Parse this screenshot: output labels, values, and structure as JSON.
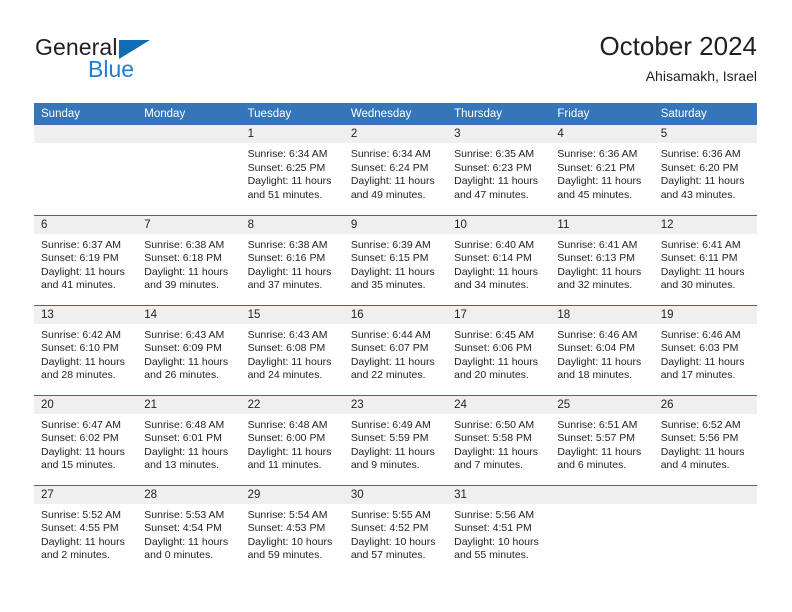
{
  "brand": {
    "name_part1": "General",
    "name_part2": "Blue",
    "triangle_color": "#0f6cb5",
    "blue_color": "#1b7fd4"
  },
  "header": {
    "title": "October 2024",
    "subtitle": "Ahisamakh, Israel"
  },
  "theme": {
    "header_bg": "#3576b8",
    "row_divider": "#2b6cab",
    "daynum_band_bg": "#efefef",
    "text_color": "#231f20"
  },
  "calendar": {
    "weekday_headers": [
      "Sunday",
      "Monday",
      "Tuesday",
      "Wednesday",
      "Thursday",
      "Friday",
      "Saturday"
    ],
    "weeks": [
      [
        {
          "day": "",
          "empty": true,
          "sunrise": "",
          "sunset": "",
          "daylight_line1": "",
          "daylight_line2": ""
        },
        {
          "day": "",
          "empty": true,
          "sunrise": "",
          "sunset": "",
          "daylight_line1": "",
          "daylight_line2": ""
        },
        {
          "day": "1",
          "empty": false,
          "sunrise": "Sunrise: 6:34 AM",
          "sunset": "Sunset: 6:25 PM",
          "daylight_line1": "Daylight: 11 hours",
          "daylight_line2": "and 51 minutes."
        },
        {
          "day": "2",
          "empty": false,
          "sunrise": "Sunrise: 6:34 AM",
          "sunset": "Sunset: 6:24 PM",
          "daylight_line1": "Daylight: 11 hours",
          "daylight_line2": "and 49 minutes."
        },
        {
          "day": "3",
          "empty": false,
          "sunrise": "Sunrise: 6:35 AM",
          "sunset": "Sunset: 6:23 PM",
          "daylight_line1": "Daylight: 11 hours",
          "daylight_line2": "and 47 minutes."
        },
        {
          "day": "4",
          "empty": false,
          "sunrise": "Sunrise: 6:36 AM",
          "sunset": "Sunset: 6:21 PM",
          "daylight_line1": "Daylight: 11 hours",
          "daylight_line2": "and 45 minutes."
        },
        {
          "day": "5",
          "empty": false,
          "sunrise": "Sunrise: 6:36 AM",
          "sunset": "Sunset: 6:20 PM",
          "daylight_line1": "Daylight: 11 hours",
          "daylight_line2": "and 43 minutes."
        }
      ],
      [
        {
          "day": "6",
          "empty": false,
          "sunrise": "Sunrise: 6:37 AM",
          "sunset": "Sunset: 6:19 PM",
          "daylight_line1": "Daylight: 11 hours",
          "daylight_line2": "and 41 minutes."
        },
        {
          "day": "7",
          "empty": false,
          "sunrise": "Sunrise: 6:38 AM",
          "sunset": "Sunset: 6:18 PM",
          "daylight_line1": "Daylight: 11 hours",
          "daylight_line2": "and 39 minutes."
        },
        {
          "day": "8",
          "empty": false,
          "sunrise": "Sunrise: 6:38 AM",
          "sunset": "Sunset: 6:16 PM",
          "daylight_line1": "Daylight: 11 hours",
          "daylight_line2": "and 37 minutes."
        },
        {
          "day": "9",
          "empty": false,
          "sunrise": "Sunrise: 6:39 AM",
          "sunset": "Sunset: 6:15 PM",
          "daylight_line1": "Daylight: 11 hours",
          "daylight_line2": "and 35 minutes."
        },
        {
          "day": "10",
          "empty": false,
          "sunrise": "Sunrise: 6:40 AM",
          "sunset": "Sunset: 6:14 PM",
          "daylight_line1": "Daylight: 11 hours",
          "daylight_line2": "and 34 minutes."
        },
        {
          "day": "11",
          "empty": false,
          "sunrise": "Sunrise: 6:41 AM",
          "sunset": "Sunset: 6:13 PM",
          "daylight_line1": "Daylight: 11 hours",
          "daylight_line2": "and 32 minutes."
        },
        {
          "day": "12",
          "empty": false,
          "sunrise": "Sunrise: 6:41 AM",
          "sunset": "Sunset: 6:11 PM",
          "daylight_line1": "Daylight: 11 hours",
          "daylight_line2": "and 30 minutes."
        }
      ],
      [
        {
          "day": "13",
          "empty": false,
          "sunrise": "Sunrise: 6:42 AM",
          "sunset": "Sunset: 6:10 PM",
          "daylight_line1": "Daylight: 11 hours",
          "daylight_line2": "and 28 minutes."
        },
        {
          "day": "14",
          "empty": false,
          "sunrise": "Sunrise: 6:43 AM",
          "sunset": "Sunset: 6:09 PM",
          "daylight_line1": "Daylight: 11 hours",
          "daylight_line2": "and 26 minutes."
        },
        {
          "day": "15",
          "empty": false,
          "sunrise": "Sunrise: 6:43 AM",
          "sunset": "Sunset: 6:08 PM",
          "daylight_line1": "Daylight: 11 hours",
          "daylight_line2": "and 24 minutes."
        },
        {
          "day": "16",
          "empty": false,
          "sunrise": "Sunrise: 6:44 AM",
          "sunset": "Sunset: 6:07 PM",
          "daylight_line1": "Daylight: 11 hours",
          "daylight_line2": "and 22 minutes."
        },
        {
          "day": "17",
          "empty": false,
          "sunrise": "Sunrise: 6:45 AM",
          "sunset": "Sunset: 6:06 PM",
          "daylight_line1": "Daylight: 11 hours",
          "daylight_line2": "and 20 minutes."
        },
        {
          "day": "18",
          "empty": false,
          "sunrise": "Sunrise: 6:46 AM",
          "sunset": "Sunset: 6:04 PM",
          "daylight_line1": "Daylight: 11 hours",
          "daylight_line2": "and 18 minutes."
        },
        {
          "day": "19",
          "empty": false,
          "sunrise": "Sunrise: 6:46 AM",
          "sunset": "Sunset: 6:03 PM",
          "daylight_line1": "Daylight: 11 hours",
          "daylight_line2": "and 17 minutes."
        }
      ],
      [
        {
          "day": "20",
          "empty": false,
          "sunrise": "Sunrise: 6:47 AM",
          "sunset": "Sunset: 6:02 PM",
          "daylight_line1": "Daylight: 11 hours",
          "daylight_line2": "and 15 minutes."
        },
        {
          "day": "21",
          "empty": false,
          "sunrise": "Sunrise: 6:48 AM",
          "sunset": "Sunset: 6:01 PM",
          "daylight_line1": "Daylight: 11 hours",
          "daylight_line2": "and 13 minutes."
        },
        {
          "day": "22",
          "empty": false,
          "sunrise": "Sunrise: 6:48 AM",
          "sunset": "Sunset: 6:00 PM",
          "daylight_line1": "Daylight: 11 hours",
          "daylight_line2": "and 11 minutes."
        },
        {
          "day": "23",
          "empty": false,
          "sunrise": "Sunrise: 6:49 AM",
          "sunset": "Sunset: 5:59 PM",
          "daylight_line1": "Daylight: 11 hours",
          "daylight_line2": "and 9 minutes."
        },
        {
          "day": "24",
          "empty": false,
          "sunrise": "Sunrise: 6:50 AM",
          "sunset": "Sunset: 5:58 PM",
          "daylight_line1": "Daylight: 11 hours",
          "daylight_line2": "and 7 minutes."
        },
        {
          "day": "25",
          "empty": false,
          "sunrise": "Sunrise: 6:51 AM",
          "sunset": "Sunset: 5:57 PM",
          "daylight_line1": "Daylight: 11 hours",
          "daylight_line2": "and 6 minutes."
        },
        {
          "day": "26",
          "empty": false,
          "sunrise": "Sunrise: 6:52 AM",
          "sunset": "Sunset: 5:56 PM",
          "daylight_line1": "Daylight: 11 hours",
          "daylight_line2": "and 4 minutes."
        }
      ],
      [
        {
          "day": "27",
          "empty": false,
          "sunrise": "Sunrise: 5:52 AM",
          "sunset": "Sunset: 4:55 PM",
          "daylight_line1": "Daylight: 11 hours",
          "daylight_line2": "and 2 minutes."
        },
        {
          "day": "28",
          "empty": false,
          "sunrise": "Sunrise: 5:53 AM",
          "sunset": "Sunset: 4:54 PM",
          "daylight_line1": "Daylight: 11 hours",
          "daylight_line2": "and 0 minutes."
        },
        {
          "day": "29",
          "empty": false,
          "sunrise": "Sunrise: 5:54 AM",
          "sunset": "Sunset: 4:53 PM",
          "daylight_line1": "Daylight: 10 hours",
          "daylight_line2": "and 59 minutes."
        },
        {
          "day": "30",
          "empty": false,
          "sunrise": "Sunrise: 5:55 AM",
          "sunset": "Sunset: 4:52 PM",
          "daylight_line1": "Daylight: 10 hours",
          "daylight_line2": "and 57 minutes."
        },
        {
          "day": "31",
          "empty": false,
          "sunrise": "Sunrise: 5:56 AM",
          "sunset": "Sunset: 4:51 PM",
          "daylight_line1": "Daylight: 10 hours",
          "daylight_line2": "and 55 minutes."
        },
        {
          "day": "",
          "empty": true,
          "sunrise": "",
          "sunset": "",
          "daylight_line1": "",
          "daylight_line2": ""
        },
        {
          "day": "",
          "empty": true,
          "sunrise": "",
          "sunset": "",
          "daylight_line1": "",
          "daylight_line2": ""
        }
      ]
    ]
  }
}
